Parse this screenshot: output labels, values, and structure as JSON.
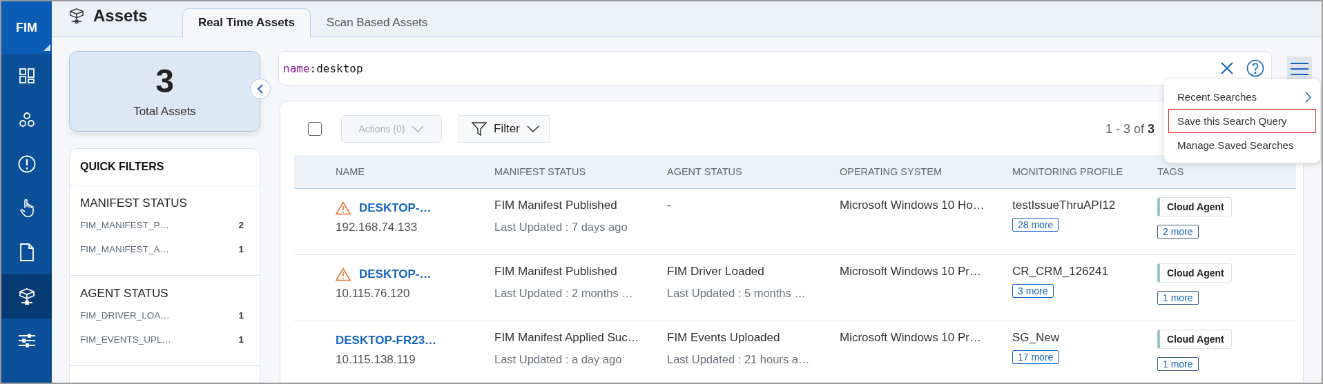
{
  "app": {
    "badge": "FIM"
  },
  "nav": [
    {
      "selected": false
    },
    {
      "selected": false
    },
    {
      "selected": false
    },
    {
      "selected": false
    },
    {
      "selected": false
    },
    {
      "selected": true
    },
    {
      "selected": false
    }
  ],
  "page": {
    "title": "Assets"
  },
  "tabs": [
    {
      "label": "Real Time Assets",
      "selected": true
    },
    {
      "label": "Scan Based Assets",
      "selected": false
    }
  ],
  "summary": {
    "count": "3",
    "label": "Total Assets"
  },
  "quick_filters": {
    "title": "QUICK FILTERS",
    "groups": [
      {
        "title": "MANIFEST STATUS",
        "items": [
          {
            "label": "FIM_MANIFEST_P…",
            "count": "2"
          },
          {
            "label": "FIM_MANIFEST_A…",
            "count": "1"
          }
        ]
      },
      {
        "title": "AGENT STATUS",
        "items": [
          {
            "label": "FIM_DRIVER_LOA…",
            "count": "1"
          },
          {
            "label": "FIM_EVENTS_UPL…",
            "count": "1"
          }
        ]
      }
    ]
  },
  "search": {
    "field": "name",
    "separator": ":",
    "term": "desktop"
  },
  "search_menu": {
    "items": [
      {
        "label": "Recent Searches",
        "submenu": true,
        "selected": false
      },
      {
        "label": "Save this Search Query",
        "submenu": false,
        "selected": true
      },
      {
        "label": "Manage Saved Searches",
        "submenu": false,
        "selected": false
      }
    ]
  },
  "toolbar": {
    "select_all": {
      "checked": false
    },
    "actions": {
      "label": "Actions (0)",
      "disabled": true
    },
    "filter": {
      "label": "Filter"
    },
    "pagination": {
      "range": "1 - 3 of",
      "total": "3"
    }
  },
  "table": {
    "columns": [
      "NAME",
      "MANIFEST STATUS",
      "AGENT STATUS",
      "OPERATING SYSTEM",
      "MONITORING PROFILE",
      "TAGS"
    ],
    "rows": [
      {
        "warning": true,
        "name": "DESKTOP-…",
        "ip": "192.168.74.133",
        "manifest_status": "FIM Manifest Published",
        "manifest_updated": "Last Updated : 7 days ago",
        "agent_status": "-",
        "os": "Microsoft Windows 10 Ho…",
        "profile": "testIssueThruAPI12",
        "profile_more": "28 more",
        "tag": "Cloud Agent",
        "tags_more": "2 more"
      },
      {
        "warning": true,
        "name": "DESKTOP-…",
        "ip": "10.115.76.120",
        "manifest_status": "FIM Manifest Published",
        "manifest_updated": "Last Updated : 2 months …",
        "agent_status": "FIM Driver Loaded",
        "agent_updated": "Last Updated : 5 months …",
        "os": "Microsoft Windows 10 Pr…",
        "profile": "CR_CRM_126241",
        "profile_more": "3 more",
        "tag": "Cloud Agent",
        "tags_more": "1 more"
      },
      {
        "warning": false,
        "name": "DESKTOP-FR23…",
        "ip": "10.115.138.119",
        "manifest_status": "FIM Manifest Applied Suc…",
        "manifest_updated": "Last Updated : a day ago",
        "agent_status": "FIM Events Uploaded",
        "agent_updated": "Last Updated : 21 hours a…",
        "os": "Microsoft Windows 10 Pr…",
        "profile": "SG_New",
        "profile_more": "17 more",
        "tag": "Cloud Agent",
        "tags_more": "1 more"
      }
    ]
  }
}
